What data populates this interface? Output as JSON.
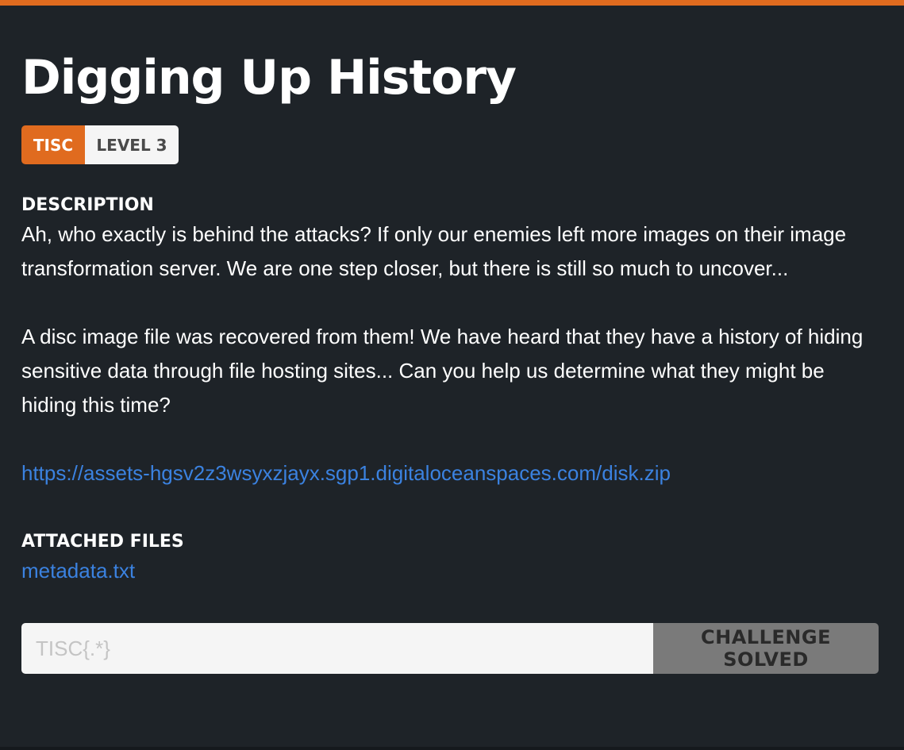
{
  "colors": {
    "accent": "#e06b1f",
    "background": "#1e2328",
    "link": "#3b82e0",
    "solved_button": "#7a7a7a"
  },
  "challenge": {
    "title": "Digging Up History",
    "category": "TISC",
    "level": "LEVEL 3"
  },
  "description": {
    "heading": "DESCRIPTION",
    "paragraphs": [
      "Ah, who exactly is behind the attacks? If only our enemies left more images on their image transformation server. We are one step closer, but there is still so much to uncover...",
      "A disc image file was recovered from them! We have heard that they have a history of hiding sensitive data through file hosting sites... Can you help us determine what they might be hiding this time?"
    ],
    "asset_link": "https://assets-hgsv2z3wsyxzjayx.sgp1.digitaloceanspaces.com/disk.zip"
  },
  "attachments": {
    "heading": "ATTACHED FILES",
    "files": [
      "metadata.txt"
    ]
  },
  "flag_form": {
    "placeholder": "TISC{.*}",
    "value": "",
    "button_label": "CHALLENGE SOLVED"
  }
}
